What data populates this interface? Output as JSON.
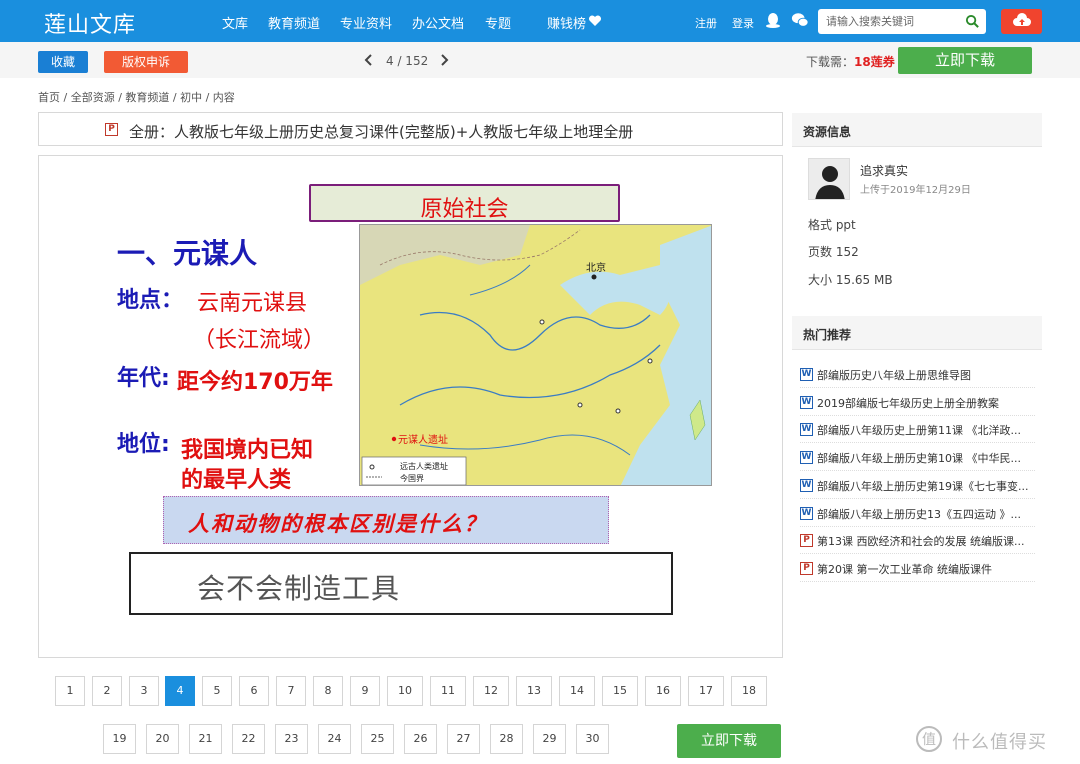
{
  "nav": {
    "logo": "莲山文库",
    "items": [
      "文库",
      "教育频道",
      "专业资料",
      "办公文档",
      "专题",
      "赚钱榜"
    ],
    "register": "注册",
    "login": "登录",
    "search_placeholder": "请输入搜索关键词"
  },
  "toolbar": {
    "favorite": "收藏",
    "report": "版权申诉",
    "page_indicator": "4 / 152",
    "download_cost_label": "下载需：",
    "download_cost": "18莲券",
    "download": "立即下载"
  },
  "breadcrumb": "首页 / 全部资源 / 教育频道 / 初中 / 内容",
  "document": {
    "type_badge": "P",
    "title": "全册：人教版七年级上册历史总复习课件(完整版)+人教版七年级上地理全册"
  },
  "slide": {
    "scroll_title": "原始社会",
    "heading": "一、元谋人",
    "place_label": "地点：",
    "place_value": "云南元谋县",
    "place_note": "（长江流域）",
    "era_label": "年代:",
    "era_value": "距今约170万年",
    "status_label": "地位:",
    "status_value_1": "我国境内已知",
    "status_value_2": "的最早人类",
    "question": "人和动物的根本区别是什么？",
    "answer": "会不会制造工具",
    "map": {
      "beijing": "北京",
      "site": "元谋人遗址",
      "legend_1": "远古人类遗址",
      "legend_2": "今国界"
    }
  },
  "pagination": {
    "pages": [
      "1",
      "2",
      "3",
      "4",
      "5",
      "6",
      "7",
      "8",
      "9",
      "10",
      "11",
      "12",
      "13",
      "14",
      "15",
      "16",
      "17",
      "18",
      "19",
      "20",
      "21",
      "22",
      "23",
      "24",
      "25",
      "26",
      "27",
      "28",
      "29",
      "30"
    ],
    "current": "4",
    "download": "立即下载"
  },
  "sidebar": {
    "info_title": "资源信息",
    "uploader": "追求真实",
    "upload_date": "上传于2019年12月29日",
    "format": "格式 ppt",
    "pages": "页数 152",
    "size": "大小 15.65 MB",
    "hot_title": "热门推荐",
    "recommendations": [
      {
        "type": "W",
        "title": "部编版历史八年级上册思维导图"
      },
      {
        "type": "W",
        "title": "2019部编版七年级历史上册全册教案"
      },
      {
        "type": "W",
        "title": "部编版八年级历史上册第11课 《北洋政..."
      },
      {
        "type": "W",
        "title": "部编版八年级上册历史第10课 《中华民..."
      },
      {
        "type": "W",
        "title": "部编版八年级上册历史第19课《七七事变..."
      },
      {
        "type": "W",
        "title": "部编版八年级上册历史13《五四运动 》..."
      },
      {
        "type": "P",
        "title": "第13课 西欧经济和社会的发展 统编版课..."
      },
      {
        "type": "P",
        "title": "第20课 第一次工业革命 统编版课件"
      }
    ]
  },
  "watermark": "什么值得买",
  "colors": {
    "nav_blue": "#1a8fde",
    "download_green": "#4cae4c",
    "report_red": "#f25a34",
    "slide_blue": "#1b1bb5",
    "slide_red": "#e01010"
  }
}
